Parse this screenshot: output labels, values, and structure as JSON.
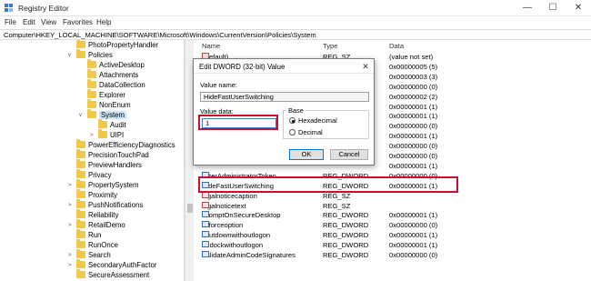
{
  "window": {
    "title": "Registry Editor",
    "minimize_glyph": "—",
    "maximize_glyph": "☐",
    "close_glyph": "✕"
  },
  "menu": [
    "File",
    "Edit",
    "View",
    "Favorites",
    "Help"
  ],
  "address": "Computer\\HKEY_LOCAL_MACHINE\\SOFTWARE\\Microsoft\\Windows\\CurrentVersion\\Policies\\System",
  "tree": [
    {
      "label": "PhotoPropertyHandler",
      "level": 0,
      "expander": ""
    },
    {
      "label": "Policies",
      "level": 0,
      "expander": "v"
    },
    {
      "label": "ActiveDesktop",
      "level": 1,
      "expander": ""
    },
    {
      "label": "Attachments",
      "level": 1,
      "expander": ""
    },
    {
      "label": "DataCollection",
      "level": 1,
      "expander": ""
    },
    {
      "label": "Explorer",
      "level": 1,
      "expander": ""
    },
    {
      "label": "NonEnum",
      "level": 1,
      "expander": ""
    },
    {
      "label": "System",
      "level": 1,
      "expander": "v",
      "selected": true
    },
    {
      "label": "Audit",
      "level": 2,
      "expander": ""
    },
    {
      "label": "UIPI",
      "level": 2,
      "expander": ">"
    },
    {
      "label": "PowerEfficiencyDiagnostics",
      "level": 0,
      "expander": ""
    },
    {
      "label": "PrecisionTouchPad",
      "level": 0,
      "expander": ""
    },
    {
      "label": "PreviewHandlers",
      "level": 0,
      "expander": ""
    },
    {
      "label": "Privacy",
      "level": 0,
      "expander": ""
    },
    {
      "label": "PropertySystem",
      "level": 0,
      "expander": ">"
    },
    {
      "label": "Proximity",
      "level": 0,
      "expander": ""
    },
    {
      "label": "PushNotifications",
      "level": 0,
      "expander": ">"
    },
    {
      "label": "Reliability",
      "level": 0,
      "expander": ""
    },
    {
      "label": "RetailDemo",
      "level": 0,
      "expander": ">"
    },
    {
      "label": "Run",
      "level": 0,
      "expander": ""
    },
    {
      "label": "RunOnce",
      "level": 0,
      "expander": ""
    },
    {
      "label": "Search",
      "level": 0,
      "expander": ">"
    },
    {
      "label": "SecondaryAuthFactor",
      "level": 0,
      "expander": ">"
    },
    {
      "label": "SecureAssessment",
      "level": 0,
      "expander": ""
    }
  ],
  "columns": {
    "name": "Name",
    "type": "Type",
    "data": "Data"
  },
  "values": [
    {
      "name": "(Default)",
      "type": "REG_SZ",
      "data": "(value not set)",
      "icon": "sz"
    },
    {
      "name": "",
      "type": "",
      "data": "0x00000005 (5)",
      "icon": ""
    },
    {
      "name": "",
      "type": "",
      "data": "0x00000003 (3)",
      "icon": ""
    },
    {
      "name": "",
      "type": "",
      "data": "0x00000000 (0)",
      "icon": ""
    },
    {
      "name": "",
      "type": "",
      "data": "0x00000002 (2)",
      "icon": ""
    },
    {
      "name": "",
      "type": "",
      "data": "0x00000001 (1)",
      "icon": ""
    },
    {
      "name": "",
      "type": "",
      "data": "0x00000001 (1)",
      "icon": ""
    },
    {
      "name": "",
      "type": "",
      "data": "0x00000000 (0)",
      "icon": ""
    },
    {
      "name": "",
      "type": "",
      "data": "0x00000001 (1)",
      "icon": ""
    },
    {
      "name": "",
      "type": "",
      "data": "0x00000000 (0)",
      "icon": ""
    },
    {
      "name": "",
      "type": "",
      "data": "0x00000000 (0)",
      "icon": ""
    },
    {
      "name": "",
      "type": "",
      "data": "0x00000001 (1)",
      "icon": ""
    },
    {
      "name": "FilterAdministratorToken",
      "type": "REG_DWORD",
      "data": "0x00000000 (0)",
      "icon": "dword"
    },
    {
      "name": "HideFastUserSwitching",
      "type": "REG_DWORD",
      "data": "0x00000001 (1)",
      "icon": "dword"
    },
    {
      "name": "legalnoticecaption",
      "type": "REG_SZ",
      "data": "",
      "icon": "sz"
    },
    {
      "name": "legalnoticetext",
      "type": "REG_SZ",
      "data": "",
      "icon": "sz"
    },
    {
      "name": "PromptOnSecureDesktop",
      "type": "REG_DWORD",
      "data": "0x00000001 (1)",
      "icon": "dword"
    },
    {
      "name": "scforceoption",
      "type": "REG_DWORD",
      "data": "0x00000000 (0)",
      "icon": "dword"
    },
    {
      "name": "shutdownwithoutlogon",
      "type": "REG_DWORD",
      "data": "0x00000001 (1)",
      "icon": "dword"
    },
    {
      "name": "undockwithoutlogon",
      "type": "REG_DWORD",
      "data": "0x00000001 (1)",
      "icon": "dword"
    },
    {
      "name": "ValidateAdminCodeSignatures",
      "type": "REG_DWORD",
      "data": "0x00000000 (0)",
      "icon": "dword"
    }
  ],
  "dialog": {
    "title": "Edit DWORD (32-bit) Value",
    "close_glyph": "✕",
    "value_name_label": "Value name:",
    "value_name": "HideFastUserSwitching",
    "value_data_label": "Value data:",
    "value_data": "1",
    "base_label": "Base",
    "hex_label": "Hexadecimal",
    "dec_label": "Decimal",
    "base_selected": "Hexadecimal",
    "ok_label": "OK",
    "cancel_label": "Cancel"
  },
  "colors": {
    "highlight": "#c8102e",
    "selection": "#cce4f7",
    "folder": "#f2c84b"
  }
}
